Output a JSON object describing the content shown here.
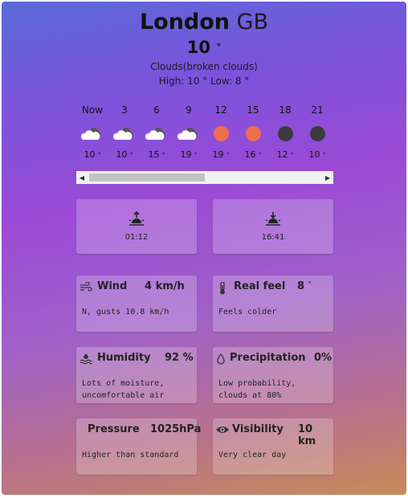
{
  "location": {
    "city": "London",
    "country": "GB"
  },
  "current": {
    "temp": "10",
    "degree": "°",
    "description": "Clouds(broken clouds)",
    "high_low": "High: 10 ° Low: 8 °"
  },
  "hourly": [
    {
      "time": "Now",
      "icon": "cloud-icon",
      "temp": "10"
    },
    {
      "time": "3",
      "icon": "cloud-icon",
      "temp": "10"
    },
    {
      "time": "6",
      "icon": "cloud-icon",
      "temp": "15"
    },
    {
      "time": "9",
      "icon": "cloud-icon",
      "temp": "19"
    },
    {
      "time": "12",
      "icon": "sun-icon",
      "temp": "19"
    },
    {
      "time": "15",
      "icon": "sun-icon",
      "temp": "16"
    },
    {
      "time": "18",
      "icon": "moon-icon",
      "temp": "12"
    },
    {
      "time": "21",
      "icon": "moon-icon",
      "temp": "10"
    }
  ],
  "sun": {
    "sunrise": {
      "icon": "sunrise-icon",
      "time": "01:12"
    },
    "sunset": {
      "icon": "sunset-icon",
      "time": "16:41"
    }
  },
  "cards": {
    "wind": {
      "icon": "wind-icon",
      "label": "Wind",
      "value": "4 km/h",
      "detail": "N, gusts 10.8 km/h"
    },
    "realfeel": {
      "icon": "thermometer-icon",
      "label": "Real feel",
      "value": "8",
      "detail": "Feels colder"
    },
    "humidity": {
      "icon": "humidity-icon",
      "label": "Humidity",
      "value": "92 %",
      "detail1": "Lots of moisture,",
      "detail2": "uncomfortable air"
    },
    "precipitation": {
      "icon": "droplet-icon",
      "label": "Precipitation",
      "value": "0%",
      "detail1": "Low probability,",
      "detail2": "clouds at 80%"
    },
    "pressure": {
      "label": "Pressure",
      "value": "1025hPa",
      "detail": "Higher than standard"
    },
    "visibility": {
      "icon": "eye-icon",
      "label": "Visibility",
      "value": "10 km",
      "detail": "Very clear day"
    }
  },
  "scrollbar": {
    "position": 0.0
  },
  "colors": {
    "sun": "#ee6e4e",
    "moon": "#3b3b3f"
  }
}
